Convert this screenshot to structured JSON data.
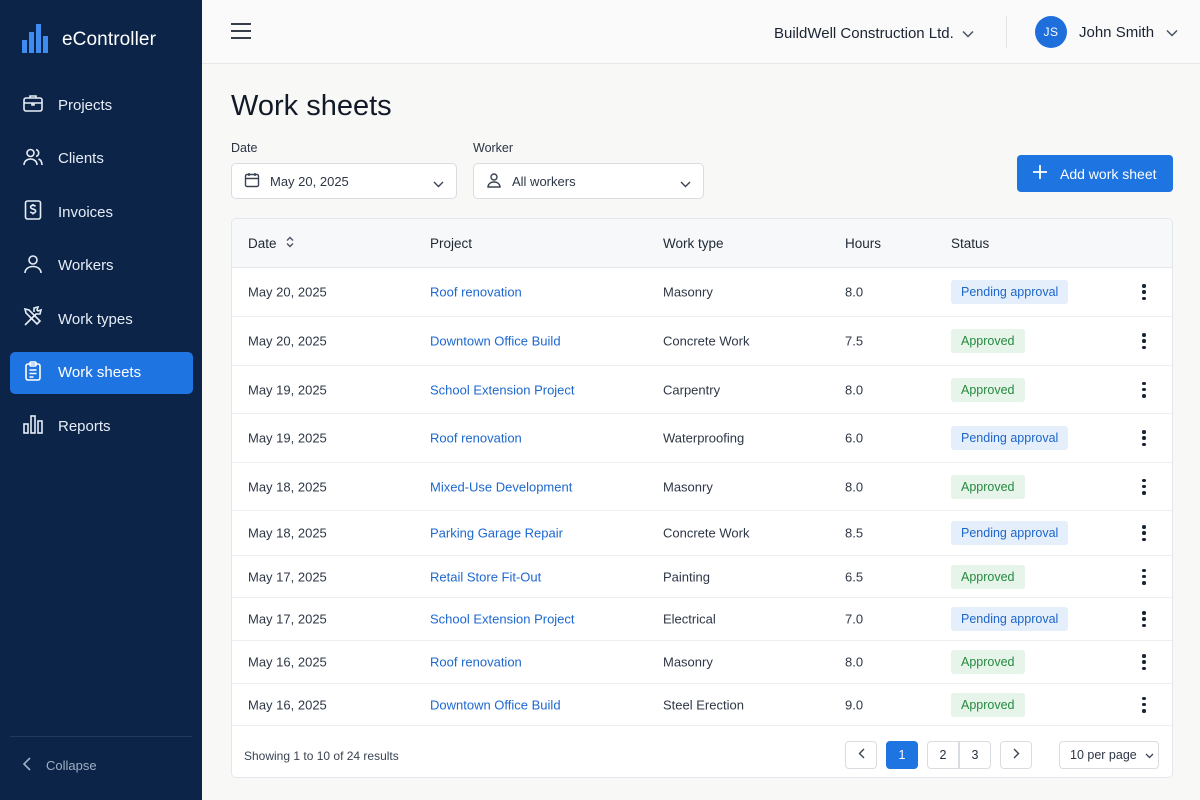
{
  "app": {
    "name": "eController"
  },
  "sidebar": {
    "items": [
      {
        "label": "Projects",
        "icon": "briefcase-icon",
        "active": false
      },
      {
        "label": "Clients",
        "icon": "users-icon",
        "active": false
      },
      {
        "label": "Invoices",
        "icon": "invoice-dollar-icon",
        "active": false
      },
      {
        "label": "Workers",
        "icon": "user-icon",
        "active": false
      },
      {
        "label": "Work types",
        "icon": "tools-icon",
        "active": false
      },
      {
        "label": "Work sheets",
        "icon": "clipboard-icon",
        "active": true
      },
      {
        "label": "Reports",
        "icon": "bar-chart-icon",
        "active": false
      }
    ],
    "collapse_label": "Collapse"
  },
  "header": {
    "company": "BuildWell Construction Ltd.",
    "user_initials": "JS",
    "user_name": "John Smith"
  },
  "page": {
    "title": "Work sheets",
    "filters": {
      "date_label": "Date",
      "date_value": "May 20, 2025",
      "worker_label": "Worker",
      "worker_value": "All workers"
    },
    "add_button": "Add work sheet"
  },
  "table": {
    "columns": [
      "Date",
      "Project",
      "Work type",
      "Hours",
      "Status"
    ],
    "rows": [
      {
        "date": "May 20, 2025",
        "project": "Roof renovation",
        "work_type": "Masonry",
        "hours": "8.0",
        "status": "Pending approval"
      },
      {
        "date": "May 20, 2025",
        "project": "Downtown Office Build",
        "work_type": "Concrete Work",
        "hours": "7.5",
        "status": "Approved"
      },
      {
        "date": "May 19, 2025",
        "project": "School Extension Project",
        "work_type": "Carpentry",
        "hours": "8.0",
        "status": "Approved"
      },
      {
        "date": "May 19, 2025",
        "project": "Roof renovation",
        "work_type": "Waterproofing",
        "hours": "6.0",
        "status": "Pending approval"
      },
      {
        "date": "May 18, 2025",
        "project": "Mixed-Use Development",
        "work_type": "Masonry",
        "hours": "8.0",
        "status": "Approved"
      },
      {
        "date": "May 18, 2025",
        "project": "Parking Garage Repair",
        "work_type": "Concrete Work",
        "hours": "8.5",
        "status": "Pending approval"
      },
      {
        "date": "May 17, 2025",
        "project": "Retail Store Fit-Out",
        "work_type": "Painting",
        "hours": "6.5",
        "status": "Approved"
      },
      {
        "date": "May 17, 2025",
        "project": "School Extension Project",
        "work_type": "Electrical",
        "hours": "7.0",
        "status": "Pending approval"
      },
      {
        "date": "May 16, 2025",
        "project": "Roof renovation",
        "work_type": "Masonry",
        "hours": "8.0",
        "status": "Approved"
      },
      {
        "date": "May 16, 2025",
        "project": "Downtown Office Build",
        "work_type": "Steel Erection",
        "hours": "9.0",
        "status": "Approved"
      }
    ]
  },
  "pagination": {
    "summary": "Showing 1 to 10 of 24 results",
    "pages": [
      "1",
      "2",
      "3"
    ],
    "current": "1",
    "per_page": "10 per page"
  },
  "colors": {
    "sidebar_bg": "#0c2447",
    "accent": "#1e74e0",
    "link": "#1d68cf",
    "pending_bg": "#e5effb",
    "approved_bg": "#e6f4e9"
  }
}
